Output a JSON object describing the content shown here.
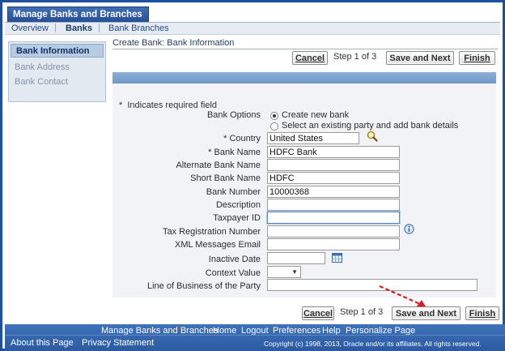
{
  "app": {
    "title": "Manage Banks and Branches"
  },
  "subtabs": {
    "overview": "Overview",
    "banks": "Banks",
    "bank_branches": "Bank Branches",
    "separator": "|"
  },
  "sidenav": {
    "active": "Bank Information",
    "items": [
      "Bank Address",
      "Bank Contact"
    ]
  },
  "page": {
    "title": "Create Bank: Bank Information"
  },
  "train_top": {
    "cancel": "Cancel",
    "step": "Step 1 of 3",
    "save_next": "Save and Next",
    "finish": "Finish"
  },
  "form": {
    "required_note": "Indicates required field",
    "required_mark": "*",
    "bank_options_label": "Bank Options",
    "bank_options": [
      {
        "label": "Create new bank",
        "checked": true
      },
      {
        "label": "Select an existing party and add bank details",
        "checked": false
      }
    ],
    "country": {
      "label": "Country",
      "value": "United States",
      "required": true
    },
    "bank_name": {
      "label": "Bank Name",
      "value": "HDFC Bank",
      "required": true
    },
    "alternate_bank_name": {
      "label": "Alternate Bank Name",
      "value": ""
    },
    "short_bank_name": {
      "label": "Short Bank Name",
      "value": "HDFC"
    },
    "bank_number": {
      "label": "Bank Number",
      "value": "10000368"
    },
    "description": {
      "label": "Description",
      "value": ""
    },
    "taxpayer_id": {
      "label": "Taxpayer ID",
      "value": ""
    },
    "tax_registration_number": {
      "label": "Tax Registration Number",
      "value": ""
    },
    "xml_messages_email": {
      "label": "XML Messages Email",
      "value": ""
    },
    "inactive_date": {
      "label": "Inactive Date",
      "value": ""
    },
    "context_value": {
      "label": "Context Value",
      "value": ""
    },
    "line_of_business": {
      "label": "Line of Business of the Party",
      "value": ""
    }
  },
  "train_bottom": {
    "cancel": "Cancel",
    "step": "Step 1 of 3",
    "save_next": "Save and Next",
    "finish": "Finish"
  },
  "footer": {
    "links": [
      "Manage Banks and Branches",
      "Home",
      "Logout",
      "Preferences",
      "Help",
      "Personalize Page"
    ],
    "about": "About this Page",
    "privacy": "Privacy Statement",
    "copyright": "Copyright (c) 1998, 2013, Oracle and/or its affiliates. All rights reserved."
  },
  "colors": {
    "brand_blue": "#2b5aa0",
    "panel_bar": "#7ea3cf",
    "annotation_arrow": "#d42020"
  },
  "icons": {
    "search": "search-icon",
    "info": "info-icon",
    "calendar": "calendar-icon",
    "dropdown": "chevron-down-icon"
  }
}
